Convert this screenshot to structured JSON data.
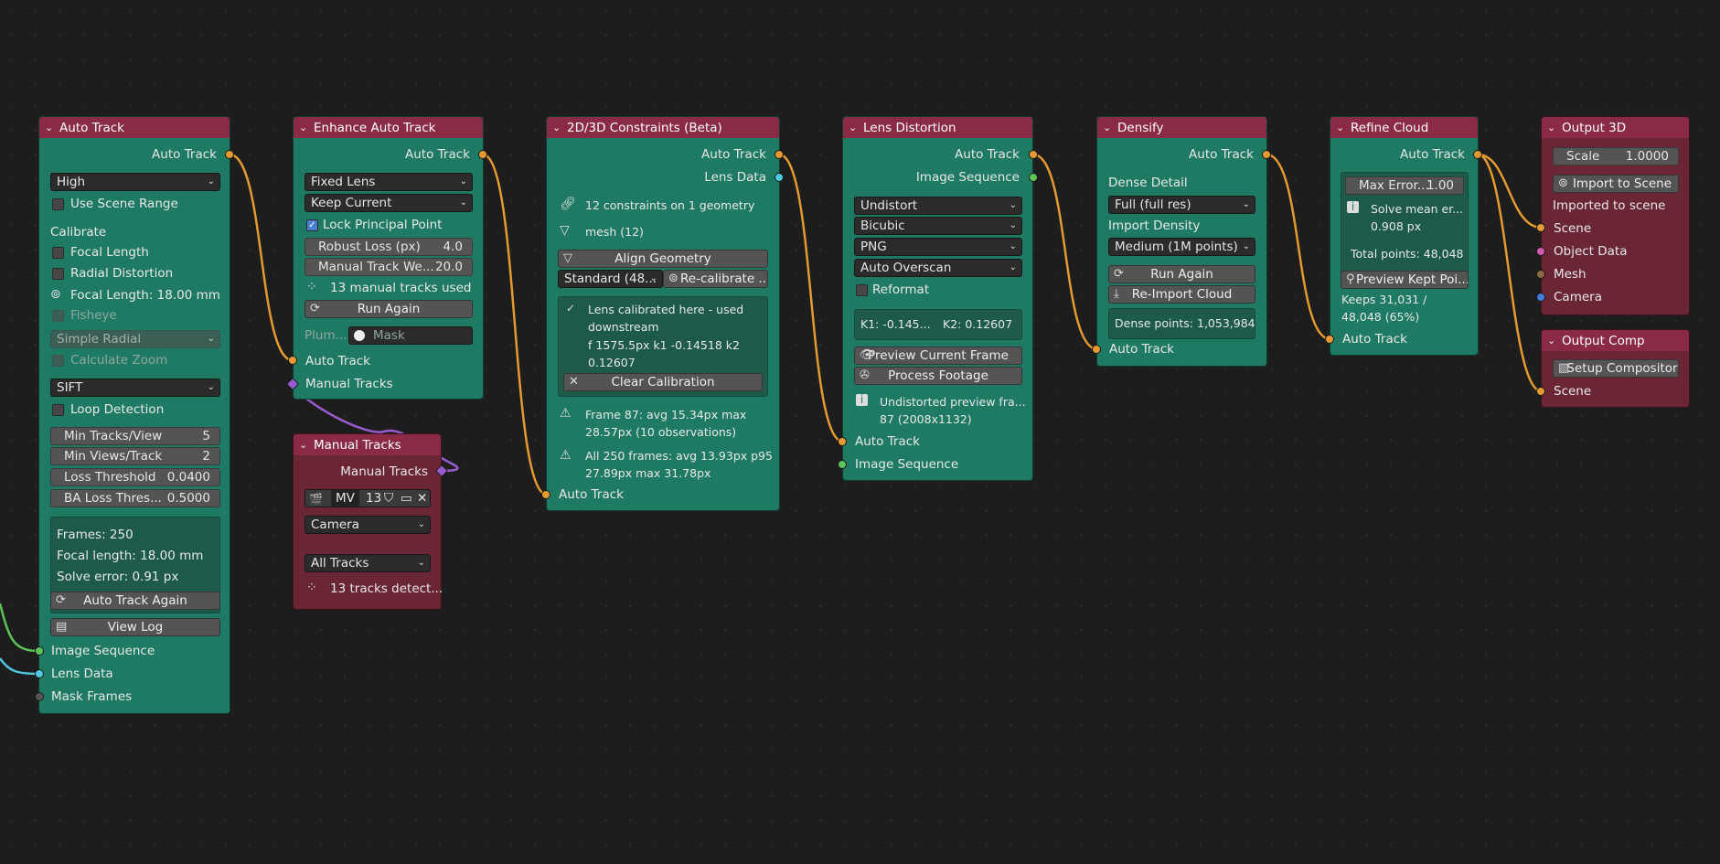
{
  "nodes": {
    "auto_track": {
      "title": "Auto Track",
      "output": "Auto Track",
      "quality": "High",
      "use_scene_range": "Use Scene Range",
      "calibrate": "Calibrate",
      "focal_length": "Focal Length",
      "radial_distortion": "Radial Distortion",
      "focal_length_value": "Focal Length: 18.00 mm",
      "fisheye": "Fisheye",
      "simple_radial": "Simple Radial",
      "calculate_zoom": "Calculate Zoom",
      "detector": "SIFT",
      "loop_detection": "Loop Detection",
      "min_tracks_view": {
        "label": "Min Tracks/View",
        "value": "5"
      },
      "min_views_track": {
        "label": "Min Views/Track",
        "value": "2"
      },
      "loss_threshold": {
        "label": "Loss Threshold",
        "value": "0.0400"
      },
      "ba_loss": {
        "label": "BA Loss Thres...",
        "value": "0.5000"
      },
      "frames": "Frames: 250",
      "focal_info": "Focal length: 18.00 mm",
      "solve_error": "Solve error: 0.91 px",
      "again_btn": "Auto Track Again",
      "log_btn": "View Log",
      "in_image_sequence": "Image Sequence",
      "in_lens_data": "Lens Data",
      "in_mask_frames": "Mask Frames"
    },
    "enhance": {
      "title": "Enhance Auto Track",
      "output": "Auto Track",
      "lens_mode": "Fixed Lens",
      "keep": "Keep Current",
      "lock_pp": "Lock Principal Point",
      "robust_loss": {
        "label": "Robust Loss (px)",
        "value": "4.0"
      },
      "manual_weight": {
        "label": "Manual Track We...",
        "value": "20.0"
      },
      "manual_used": "13 manual tracks used",
      "run_btn": "Run Again",
      "plumb_label": "Plum...",
      "mask_placeholder": "Mask",
      "in_auto_track": "Auto Track",
      "in_manual_tracks": "Manual Tracks"
    },
    "manual_tracks": {
      "title": "Manual Tracks",
      "output": "Manual Tracks",
      "mv": "MV",
      "count": "13",
      "camera": "Camera",
      "all_tracks": "All Tracks",
      "detected": "13 tracks detect..."
    },
    "constraints": {
      "title": "2D/3D Constraints (Beta)",
      "out_auto_track": "Auto Track",
      "out_lens_data": "Lens Data",
      "constraints_info": "12 constraints on 1 geometry",
      "mesh_info": "mesh  (12)",
      "align_btn": "Align Geometry",
      "standard": "Standard (48...",
      "recal_btn": "Re-calibrate ...",
      "calib_line1": "Lens calibrated here - used",
      "calib_line2": "downstream",
      "calib_line3": "f 1575.5px  k1 -0.14518  k2",
      "calib_line4": "0.12607",
      "clear_btn": "Clear Calibration",
      "frame_line1": "Frame 87: avg 15.34px  max",
      "frame_line2": "28.57px  (10 observations)",
      "all_line1": "All 250 frames: avg 13.93px  p95",
      "all_line2": "27.89px  max 31.78px",
      "in_auto_track": "Auto Track"
    },
    "lens_distortion": {
      "title": "Lens Distortion",
      "out_auto_track": "Auto Track",
      "out_image_sequence": "Image Sequence",
      "mode": "Undistort",
      "interp": "Bicubic",
      "format": "PNG",
      "overscan": "Auto Overscan",
      "reformat": "Reformat",
      "k1": "K1: -0.145...",
      "k2": "K2: 0.12607",
      "preview_btn": "Preview Current Frame",
      "process_btn": "Process Footage",
      "info_line1": "Undistorted preview fra...",
      "info_line2": "87 (2008x1132)",
      "in_auto_track": "Auto Track",
      "in_image_sequence": "Image Sequence"
    },
    "densify": {
      "title": "Densify",
      "output": "Auto Track",
      "dense_detail": "Dense Detail",
      "detail_value": "Full (full res)",
      "import_density": "Import Density",
      "density_value": "Medium (1M points)",
      "run_btn": "Run Again",
      "reimport_btn": "Re-Import Cloud",
      "dense_points": "Dense points: 1,053,984",
      "in_auto_track": "Auto Track"
    },
    "refine": {
      "title": "Refine Cloud",
      "output": "Auto Track",
      "max_error": {
        "label": "Max Error...",
        "value": "1.00"
      },
      "solve_line1": "Solve mean er...",
      "solve_line2": "0.908 px",
      "total_points": "Total points: 48,048",
      "preview_btn": "Preview Kept Poi...",
      "keeps_line1": "Keeps 31,031 /",
      "keeps_line2": "48,048 (65%)",
      "in_auto_track": "Auto Track"
    },
    "output3d": {
      "title": "Output 3D",
      "scale": {
        "label": "Scale",
        "value": "1.0000"
      },
      "import_btn": "Import to Scene",
      "imported": "Imported to scene",
      "in_scene": "Scene",
      "in_object": "Object Data",
      "in_mesh": "Mesh",
      "in_camera": "Camera"
    },
    "outputcomp": {
      "title": "Output Comp",
      "setup_btn": "Setup Compositor",
      "in_scene": "Scene"
    }
  }
}
